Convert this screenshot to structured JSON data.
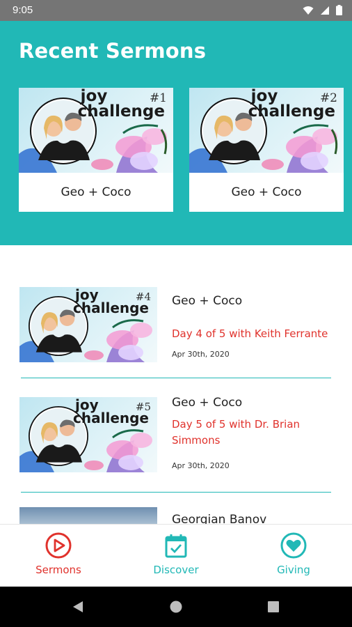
{
  "status_bar": {
    "time": "9:05"
  },
  "hero": {
    "title": "Recent Sermons",
    "cards": [
      {
        "label": "Geo + Coco",
        "thumb_title_line1": "joy",
        "thumb_title_line2": "challenge",
        "thumb_number": "#1"
      },
      {
        "label": "Geo + Coco",
        "thumb_title_line1": "joy",
        "thumb_title_line2": "challenge",
        "thumb_number": "#2"
      }
    ]
  },
  "list": {
    "items": [
      {
        "title": "Geo + Coco",
        "subtitle": "Day 4 of 5 with Keith Ferrante",
        "date": "Apr 30th, 2020",
        "thumb_title_line1": "joy",
        "thumb_title_line2": "challenge",
        "thumb_number": "#4"
      },
      {
        "title": "Geo + Coco",
        "subtitle": "Day 5 of 5 with Dr. Brian Simmons",
        "date": "Apr 30th, 2020",
        "thumb_title_line1": "joy",
        "thumb_title_line2": "challenge",
        "thumb_number": "#5"
      },
      {
        "title": "Georgian Banov"
      }
    ]
  },
  "bottom_nav": {
    "items": [
      {
        "label": "Sermons",
        "icon": "play-circle-icon",
        "active": true
      },
      {
        "label": "Discover",
        "icon": "calendar-check-icon",
        "active": false
      },
      {
        "label": "Giving",
        "icon": "heart-circle-icon",
        "active": false
      }
    ]
  },
  "colors": {
    "accent": "#21b8b6",
    "active": "#e0322c",
    "status_bar": "#757575"
  }
}
